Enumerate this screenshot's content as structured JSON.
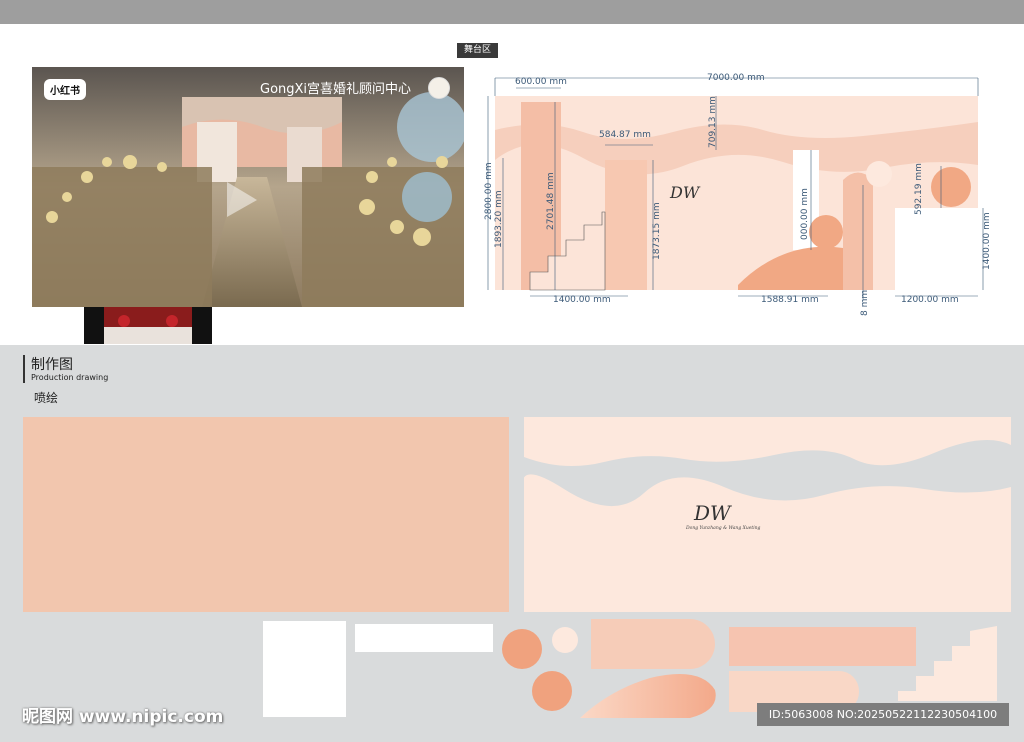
{
  "stage_label": "舞台区",
  "photo": {
    "app_badge": "小红书",
    "title": "GongXi宫喜婚礼顾问中心"
  },
  "drawing": {
    "dimensions": {
      "total_width": "7000.00 mm",
      "left_column_width": "600.00 mm",
      "left_height": "2800.00 mm",
      "left_inner_height": "1893.20 mm",
      "column_height": "2701.48 mm",
      "top_gap": "709.13 mm",
      "right_column_width": "584.87 mm",
      "right_column_height": "1873.15 mm",
      "stair_width": "1400.00 mm",
      "small_panel_height": "000.00 mm",
      "mound_width": "1588.91 mm",
      "eight": "8 mm",
      "circle_height": "592.19 mm",
      "right_panel_height": "1400.00 mm",
      "right_panel_width": "1200.00 mm"
    },
    "monogram": "DW"
  },
  "production": {
    "title": "制作图",
    "subtitle": "Production drawing",
    "section_label": "喷绘",
    "panel_monogram": "DW",
    "panel_caption": "Dong Yunzhang & Wang Xueting"
  },
  "colors": {
    "peach": "#f2c6ae",
    "light_peach": "#fbe5da",
    "coral": "#f0a27e",
    "grey_bg": "#d9dbdc",
    "dimension_line": "#3c5a78"
  },
  "watermarks": {
    "site": "昵图网 www.nipic.com",
    "id_text": "ID:5063008 NO:20250522112230504100"
  }
}
